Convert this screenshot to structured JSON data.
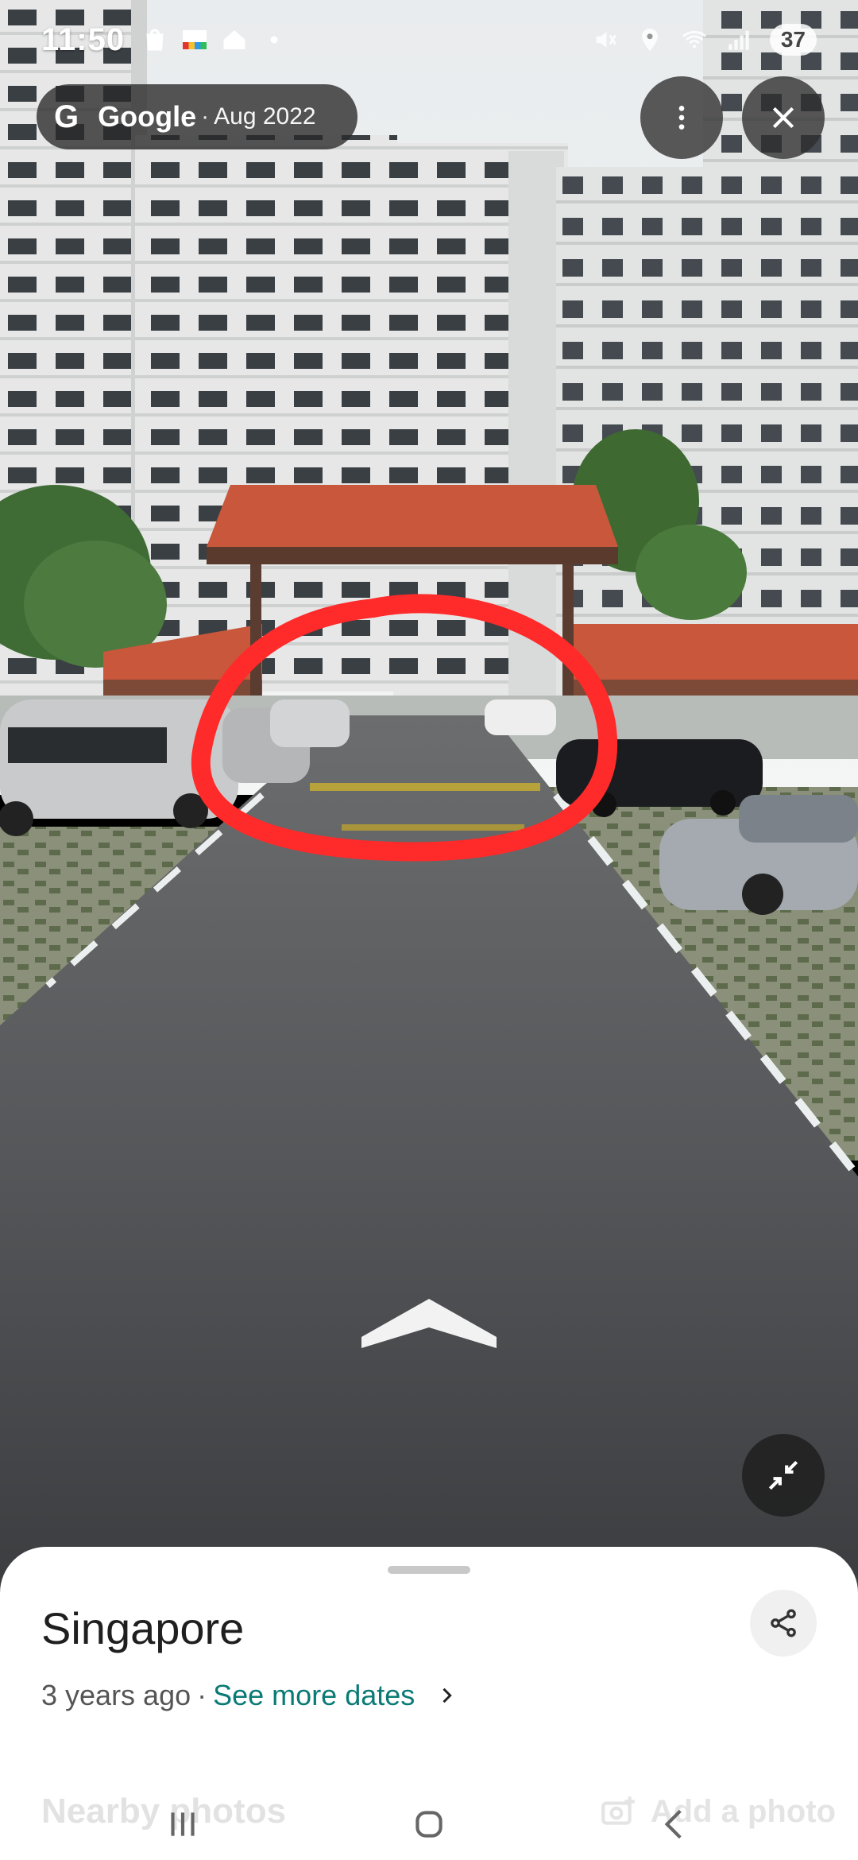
{
  "status": {
    "time": "11:50",
    "battery": "37",
    "left_icons": [
      "shopping-bag-icon",
      "axs-app-icon",
      "home-icon",
      "dot-icon"
    ],
    "right_icons": [
      "mute-icon",
      "location-icon",
      "wifi-icon",
      "signal-icon"
    ]
  },
  "header": {
    "provider": "Google",
    "date": "Aug 2022",
    "logo_letter": "G"
  },
  "sheet": {
    "title": "Singapore",
    "age": "3 years ago",
    "more_dates": "See more dates",
    "nearby_label": "Nearby photos",
    "add_photo": "Add a photo"
  },
  "colors": {
    "accent_link": "#0b7a75",
    "annotation_circle": "#ff2a2a",
    "roof_tile": "#c8573c"
  },
  "icons": {
    "more": "vertical-ellipsis-icon",
    "close": "close-icon",
    "collapse": "collapse-arrows-icon",
    "share": "share-icon",
    "chevron": "chevron-right-icon",
    "camera": "add-photo-camera-icon",
    "navigate": "navigation-arrow-icon"
  }
}
